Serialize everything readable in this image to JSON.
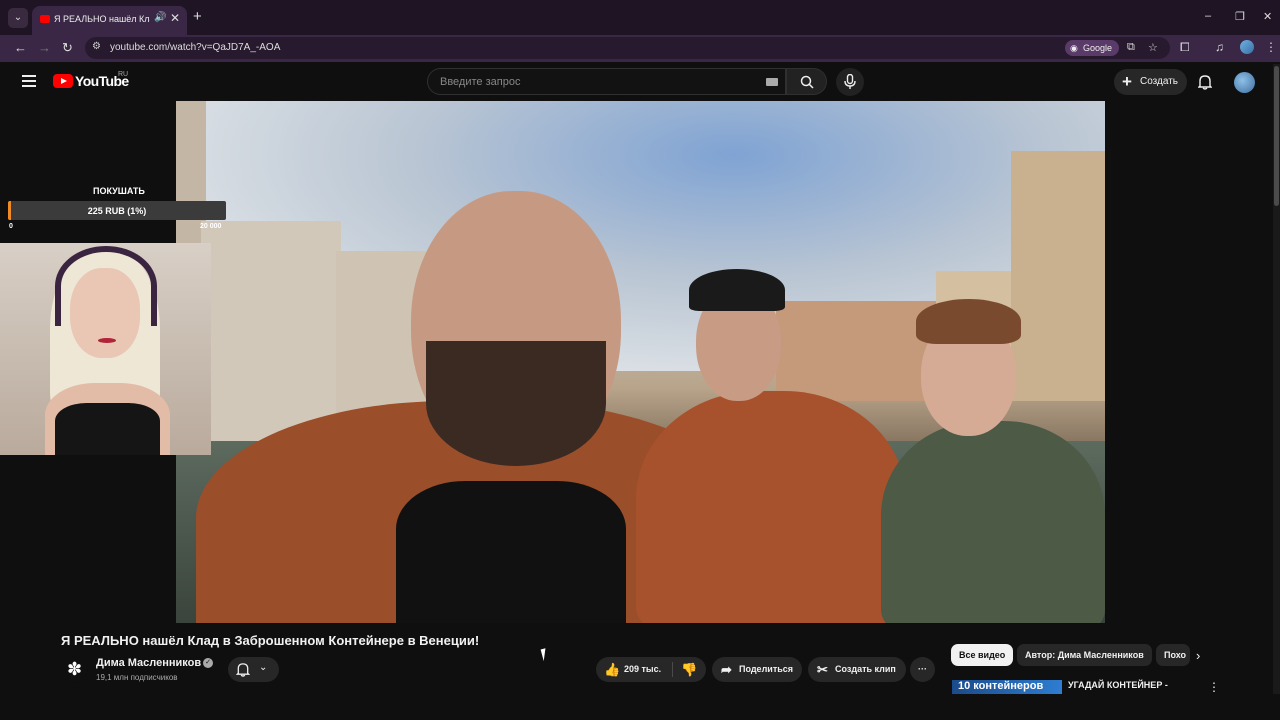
{
  "browser": {
    "tab_title": "Я РЕАЛЬНО нашёл Клад в",
    "url": "youtube.com/watch?v=QaJD7A_-AOA",
    "google_pill": "Google",
    "new_tab": "+",
    "tab_close": "✕",
    "win_min": "–",
    "win_restore": "❐",
    "win_close": "✕"
  },
  "youtube": {
    "logo_text": "YouTube",
    "region": "RU",
    "search_placeholder": "Введите запрос",
    "create_label": "Создать"
  },
  "stream_overlay": {
    "goal_title": "ПОКУШАТЬ",
    "goal_text": "225 RUB (1%)",
    "goal_progress": 0.0113,
    "goal_min": "0",
    "goal_max": "20 000"
  },
  "video": {
    "title": "Я РЕАЛЬНО нашёл Клад в Заброшенном Контейнере в Венеции!",
    "channel_name": "Дима Масленников",
    "subscribers": "19,1 млн подписчиков",
    "likes": "209 тыс.",
    "share_label": "Поделиться",
    "clip_label": "Создать клип",
    "more_label": "···"
  },
  "chips": [
    "Все видео",
    "Автор: Дима Масленников",
    "Похо"
  ],
  "recommendation": {
    "thumb_text": "10 контейнеров",
    "title": "УГАДАЙ КОНТЕЙНЕР -"
  },
  "colors": {
    "youtube_red": "#ff0000",
    "goal_fill": "#f08a24",
    "chrome_frame": "#1f1424",
    "chrome_toolbar": "#3a2745"
  }
}
